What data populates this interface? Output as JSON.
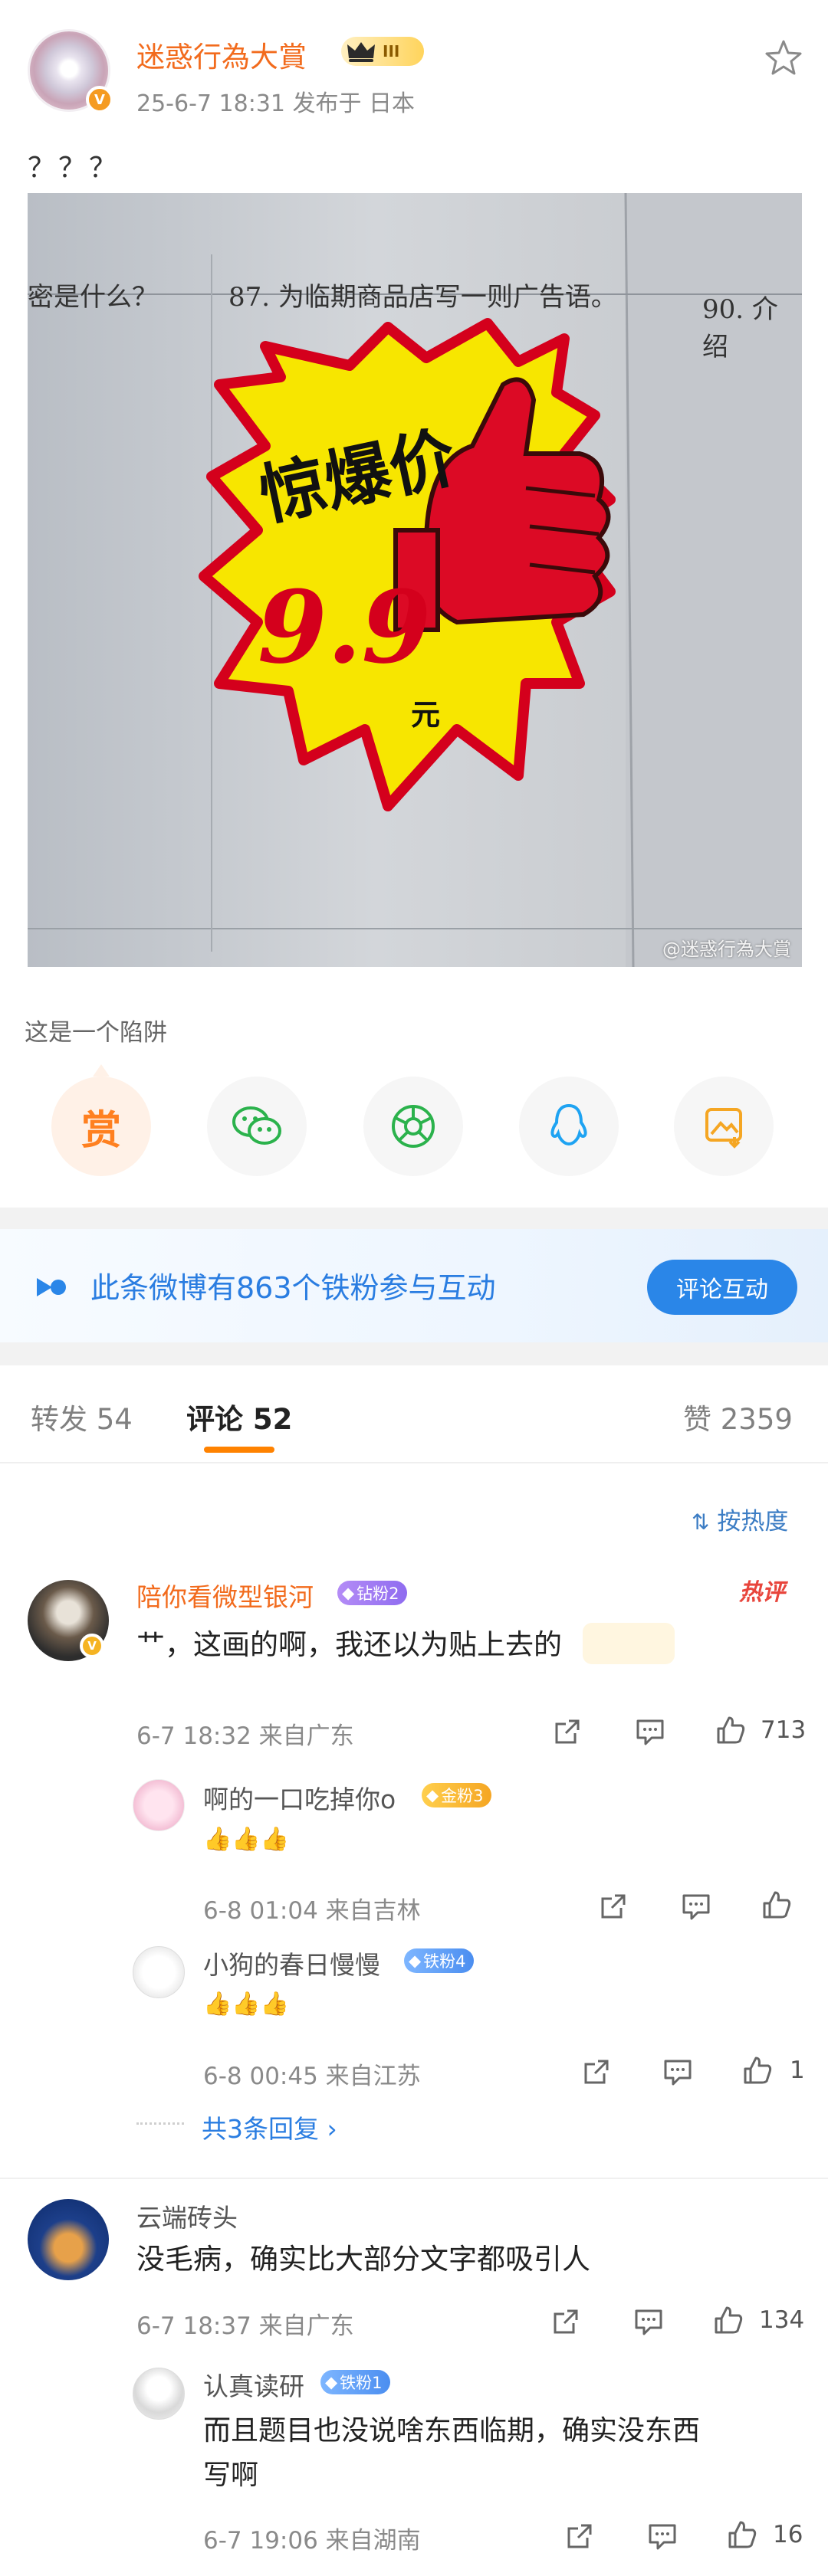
{
  "post": {
    "author": "迷惑行為大賞",
    "level_badge": "III",
    "meta": "25-6-7 18:31  发布于 日本",
    "text": "？？？",
    "image": {
      "watermark": "@迷惑行為大賞",
      "q_left": "密是什么？",
      "q_middle": "87. 为临期商品店写一则广告语。",
      "q_right": "90. 介绍",
      "sticker_headline": "惊爆价",
      "sticker_price": "9.9",
      "sticker_unit": "元"
    },
    "caption": "这是一个陷阱",
    "share": {
      "reward_label": "赏",
      "targets": [
        "reward-icon",
        "wechat-icon",
        "moments-icon",
        "qq-icon",
        "save-image-icon"
      ]
    }
  },
  "banner": {
    "text": "此条微博有863个铁粉参与互动",
    "button": "评论互动"
  },
  "tabs": {
    "repost": "转发 54",
    "comments": "评论 52",
    "likes": "赞 2359"
  },
  "sort_label": "按热度",
  "comments": [
    {
      "name": "陪你看微型银河",
      "badge": "钻粉2",
      "hot_tag": "热评",
      "text": "艹，这画的啊，我还以为贴上去的",
      "meta": "6-7 18:32  来自广东",
      "likes": "713",
      "replies": [
        {
          "name": "啊的一口吃掉你o",
          "badge": "金粉3",
          "text": "👍👍👍",
          "meta": "6-8 01:04  来自吉林",
          "likes": ""
        },
        {
          "name": "小狗的春日慢慢",
          "badge": "铁粉4",
          "text": "👍👍👍",
          "meta": "6-8 00:45  来自江苏",
          "likes": "1"
        }
      ],
      "more_replies": "共3条回复 ›"
    },
    {
      "name": "云端砖头",
      "text": "没毛病，确实比大部分文字都吸引人",
      "meta": "6-7 18:37  来自广东",
      "likes": "134",
      "replies": [
        {
          "name": "认真读研",
          "badge": "铁粉1",
          "text_line1": "而且题目也没说啥东西临期，确实没东西",
          "text_line2": "写啊",
          "meta": "6-7 19:06  来自湖南",
          "likes": "16"
        }
      ]
    }
  ],
  "colors": {
    "accent_orange": "#f26b1d",
    "link_blue": "#2a7de1",
    "tab_underline": "#ff8200"
  }
}
